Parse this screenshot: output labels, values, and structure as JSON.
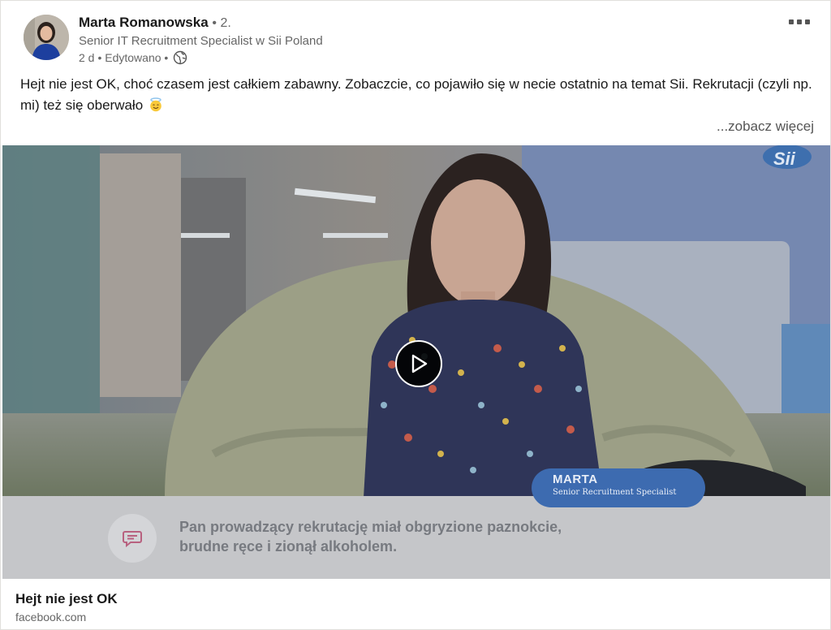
{
  "author": {
    "name": "Marta Romanowska",
    "degree": "• 2.",
    "headline": "Senior IT Recruitment Specialist w Sii Poland",
    "time": "2 d",
    "edited": "• Edytowano •"
  },
  "post": {
    "text": "Hejt nie jest OK, choć czasem jest całkiem zabawny. Zobaczcie, co pojawiło się w necie ostatnio na temat Sii. Rekrutacji (czyli np. mi) też się oberwało",
    "see_more": "...zobacz więcej"
  },
  "video": {
    "overlay_name": "MARTA",
    "overlay_role": "Senior Recruitment Specialist",
    "caption_line1": "Pan prowadzący rekrutację miał obgryzione paznokcie,",
    "caption_line2": "brudne ręce i zionął alkoholem.",
    "logo_text": "Sii"
  },
  "link": {
    "title": "Hejt nie jest OK",
    "domain": "facebook.com"
  },
  "icons": {
    "more": "more-horizontal-icon",
    "globe": "globe-icon",
    "emoji": "smiling-face-with-halo",
    "play": "play-icon",
    "quote": "speech-bubble-icon"
  },
  "colors": {
    "name_tag": "#3d6bb0",
    "caption_band": "#c5c6c9",
    "secondary_text": "#666666"
  }
}
